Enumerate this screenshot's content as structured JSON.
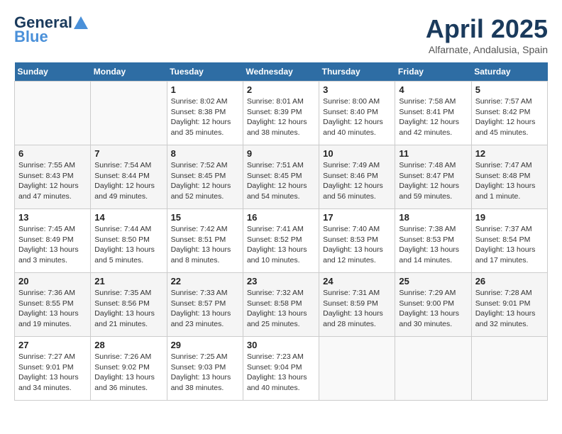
{
  "header": {
    "logo_line1": "General",
    "logo_line2": "Blue",
    "title": "April 2025",
    "subtitle": "Alfarnate, Andalusia, Spain"
  },
  "days_of_week": [
    "Sunday",
    "Monday",
    "Tuesday",
    "Wednesday",
    "Thursday",
    "Friday",
    "Saturday"
  ],
  "weeks": [
    [
      {
        "day": "",
        "info": ""
      },
      {
        "day": "",
        "info": ""
      },
      {
        "day": "1",
        "info": "Sunrise: 8:02 AM\nSunset: 8:38 PM\nDaylight: 12 hours\nand 35 minutes."
      },
      {
        "day": "2",
        "info": "Sunrise: 8:01 AM\nSunset: 8:39 PM\nDaylight: 12 hours\nand 38 minutes."
      },
      {
        "day": "3",
        "info": "Sunrise: 8:00 AM\nSunset: 8:40 PM\nDaylight: 12 hours\nand 40 minutes."
      },
      {
        "day": "4",
        "info": "Sunrise: 7:58 AM\nSunset: 8:41 PM\nDaylight: 12 hours\nand 42 minutes."
      },
      {
        "day": "5",
        "info": "Sunrise: 7:57 AM\nSunset: 8:42 PM\nDaylight: 12 hours\nand 45 minutes."
      }
    ],
    [
      {
        "day": "6",
        "info": "Sunrise: 7:55 AM\nSunset: 8:43 PM\nDaylight: 12 hours\nand 47 minutes."
      },
      {
        "day": "7",
        "info": "Sunrise: 7:54 AM\nSunset: 8:44 PM\nDaylight: 12 hours\nand 49 minutes."
      },
      {
        "day": "8",
        "info": "Sunrise: 7:52 AM\nSunset: 8:45 PM\nDaylight: 12 hours\nand 52 minutes."
      },
      {
        "day": "9",
        "info": "Sunrise: 7:51 AM\nSunset: 8:45 PM\nDaylight: 12 hours\nand 54 minutes."
      },
      {
        "day": "10",
        "info": "Sunrise: 7:49 AM\nSunset: 8:46 PM\nDaylight: 12 hours\nand 56 minutes."
      },
      {
        "day": "11",
        "info": "Sunrise: 7:48 AM\nSunset: 8:47 PM\nDaylight: 12 hours\nand 59 minutes."
      },
      {
        "day": "12",
        "info": "Sunrise: 7:47 AM\nSunset: 8:48 PM\nDaylight: 13 hours\nand 1 minute."
      }
    ],
    [
      {
        "day": "13",
        "info": "Sunrise: 7:45 AM\nSunset: 8:49 PM\nDaylight: 13 hours\nand 3 minutes."
      },
      {
        "day": "14",
        "info": "Sunrise: 7:44 AM\nSunset: 8:50 PM\nDaylight: 13 hours\nand 5 minutes."
      },
      {
        "day": "15",
        "info": "Sunrise: 7:42 AM\nSunset: 8:51 PM\nDaylight: 13 hours\nand 8 minutes."
      },
      {
        "day": "16",
        "info": "Sunrise: 7:41 AM\nSunset: 8:52 PM\nDaylight: 13 hours\nand 10 minutes."
      },
      {
        "day": "17",
        "info": "Sunrise: 7:40 AM\nSunset: 8:53 PM\nDaylight: 13 hours\nand 12 minutes."
      },
      {
        "day": "18",
        "info": "Sunrise: 7:38 AM\nSunset: 8:53 PM\nDaylight: 13 hours\nand 14 minutes."
      },
      {
        "day": "19",
        "info": "Sunrise: 7:37 AM\nSunset: 8:54 PM\nDaylight: 13 hours\nand 17 minutes."
      }
    ],
    [
      {
        "day": "20",
        "info": "Sunrise: 7:36 AM\nSunset: 8:55 PM\nDaylight: 13 hours\nand 19 minutes."
      },
      {
        "day": "21",
        "info": "Sunrise: 7:35 AM\nSunset: 8:56 PM\nDaylight: 13 hours\nand 21 minutes."
      },
      {
        "day": "22",
        "info": "Sunrise: 7:33 AM\nSunset: 8:57 PM\nDaylight: 13 hours\nand 23 minutes."
      },
      {
        "day": "23",
        "info": "Sunrise: 7:32 AM\nSunset: 8:58 PM\nDaylight: 13 hours\nand 25 minutes."
      },
      {
        "day": "24",
        "info": "Sunrise: 7:31 AM\nSunset: 8:59 PM\nDaylight: 13 hours\nand 28 minutes."
      },
      {
        "day": "25",
        "info": "Sunrise: 7:29 AM\nSunset: 9:00 PM\nDaylight: 13 hours\nand 30 minutes."
      },
      {
        "day": "26",
        "info": "Sunrise: 7:28 AM\nSunset: 9:01 PM\nDaylight: 13 hours\nand 32 minutes."
      }
    ],
    [
      {
        "day": "27",
        "info": "Sunrise: 7:27 AM\nSunset: 9:01 PM\nDaylight: 13 hours\nand 34 minutes."
      },
      {
        "day": "28",
        "info": "Sunrise: 7:26 AM\nSunset: 9:02 PM\nDaylight: 13 hours\nand 36 minutes."
      },
      {
        "day": "29",
        "info": "Sunrise: 7:25 AM\nSunset: 9:03 PM\nDaylight: 13 hours\nand 38 minutes."
      },
      {
        "day": "30",
        "info": "Sunrise: 7:23 AM\nSunset: 9:04 PM\nDaylight: 13 hours\nand 40 minutes."
      },
      {
        "day": "",
        "info": ""
      },
      {
        "day": "",
        "info": ""
      },
      {
        "day": "",
        "info": ""
      }
    ]
  ]
}
